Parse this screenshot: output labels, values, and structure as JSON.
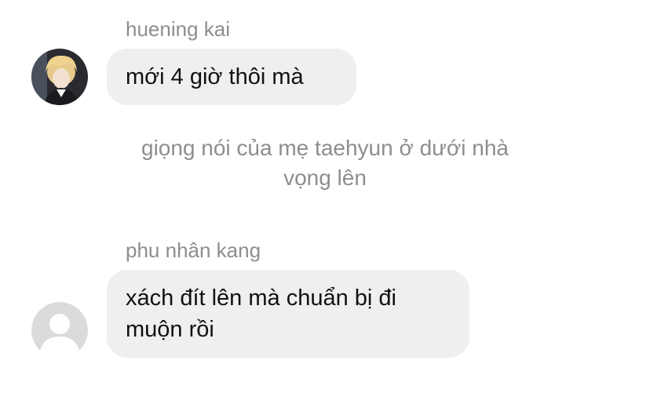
{
  "messages": [
    {
      "sender": "huening kai",
      "text": "mới 4 giờ thôi mà",
      "avatar": "photo-avatar"
    },
    {
      "sender": "phu nhân kang",
      "text_line1": "xách đít lên mà chuẩn bị đi",
      "text_line2": "muộn rồi",
      "avatar": "default-user-avatar"
    }
  ],
  "narration": {
    "line1": "giọng nói của mẹ taehyun ở dưới nhà",
    "line2": "vọng lên"
  },
  "colors": {
    "bubble_bg": "#efefef",
    "secondary_text": "#8e8e8e",
    "primary_text": "#111111"
  }
}
